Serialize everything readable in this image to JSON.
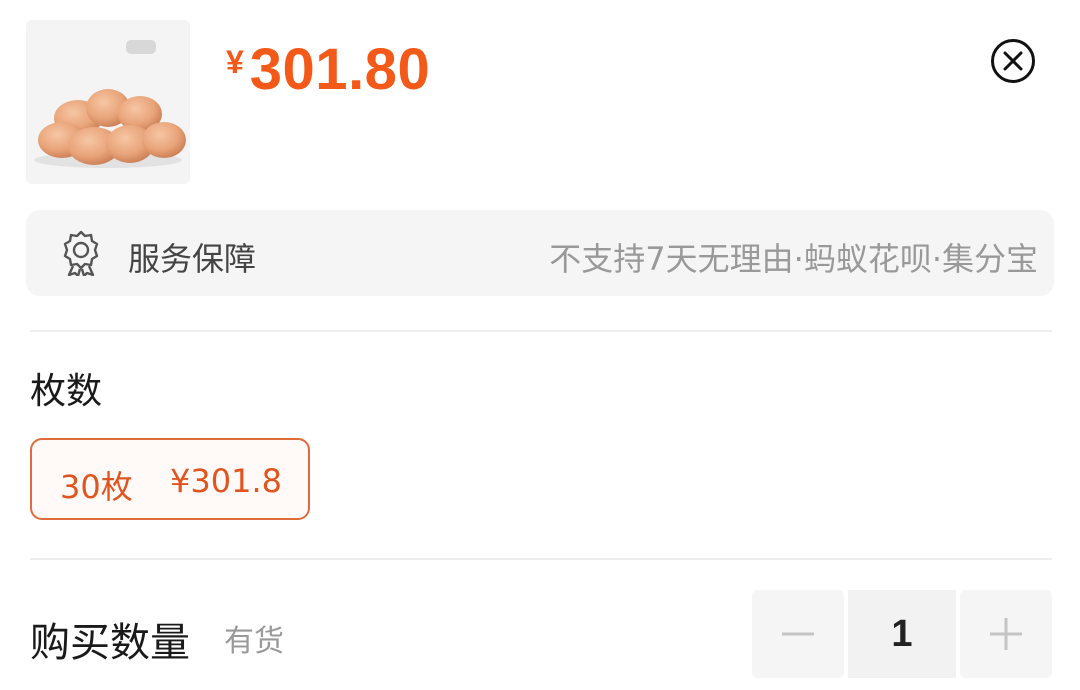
{
  "product": {
    "image": "eggs-image",
    "currency_symbol": "¥",
    "price": "301.80"
  },
  "service": {
    "icon": "ribbon-badge-icon",
    "label": "服务保障",
    "detail": "不支持7天无理由·蚂蚁花呗·集分宝"
  },
  "spec": {
    "title": "枚数",
    "options": [
      {
        "name": "30枚",
        "price": "¥301.8",
        "selected": true
      }
    ]
  },
  "quantity": {
    "title": "购买数量",
    "stock": "有货",
    "value": "1"
  },
  "colors": {
    "accent": "#f35a19",
    "option_border": "#e06b3c",
    "muted_text": "#999999",
    "panel_bg": "#f5f5f5"
  }
}
